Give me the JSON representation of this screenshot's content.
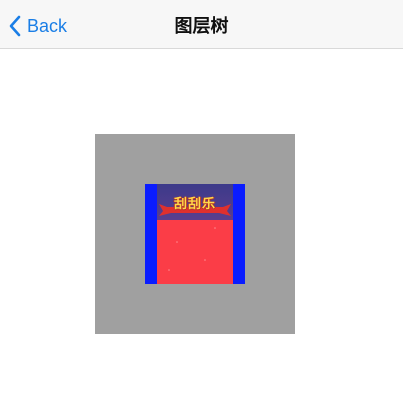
{
  "navbar": {
    "back_label": "Back",
    "title": "图层树"
  },
  "layers": {
    "root_color": "#a0a0a0",
    "child_color": "#0a1cff",
    "card": {
      "logo_text": "刮刮乐",
      "header_color": "#463b8c",
      "body_color": "#fb3d47",
      "banner_color": "#e0302e"
    }
  },
  "colors": {
    "accent": "#1a7ee6",
    "navbar_bg": "#f7f7f7"
  },
  "icons": {
    "back": "chevron-left-icon"
  }
}
